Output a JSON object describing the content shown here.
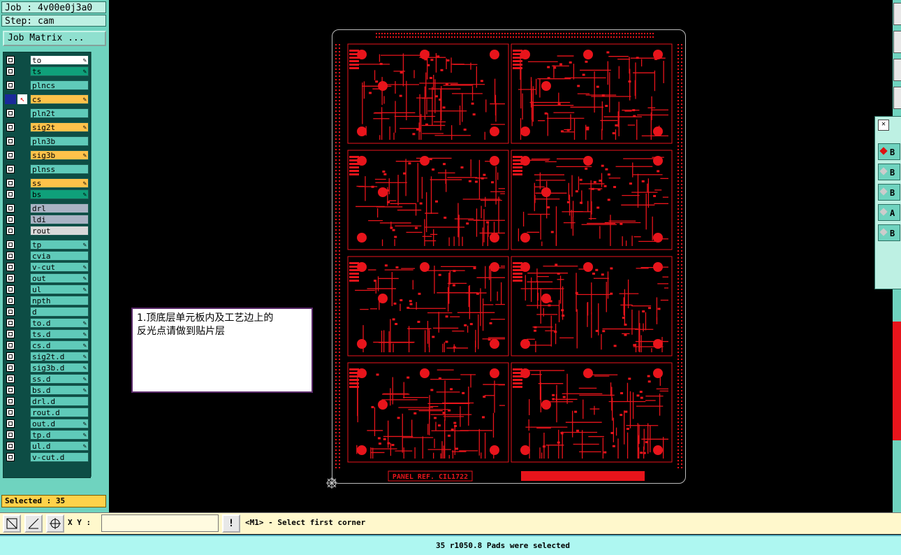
{
  "header": {
    "job": "Job : 4v00e0j3a0",
    "step": "Step: cam"
  },
  "job_matrix_label": "Job Matrix ...",
  "layers": [
    {
      "name": "to",
      "color": "#ffffff",
      "edit": true
    },
    {
      "name": "ts",
      "color": "#0fa07a",
      "edit": true
    },
    {
      "name": "plncs",
      "color": "#5fcab9",
      "edit": false
    },
    {
      "name": "cs",
      "color": "#ffc24a",
      "edit": true,
      "active": true
    },
    {
      "name": "pln2t",
      "color": "#5fcab9",
      "edit": false
    },
    {
      "name": "sig2t",
      "color": "#ffc24a",
      "edit": true
    },
    {
      "name": "pln3b",
      "color": "#5fcab9",
      "edit": false
    },
    {
      "name": "sig3b",
      "color": "#ffc24a",
      "edit": true
    },
    {
      "name": "plnss",
      "color": "#5fcab9",
      "edit": false
    },
    {
      "name": "ss",
      "color": "#ffc24a",
      "edit": true
    },
    {
      "name": "bs",
      "color": "#0fa07a",
      "edit": true
    },
    {
      "name": "drl",
      "color": "#a9b3c4",
      "edit": false
    },
    {
      "name": "ldi",
      "color": "#a9b3c4",
      "edit": false
    },
    {
      "name": "rout",
      "color": "#d9d9d9",
      "edit": false
    },
    {
      "name": "tp",
      "color": "#5fcab9",
      "edit": true
    },
    {
      "name": "cvia",
      "color": "#5fcab9",
      "edit": false
    },
    {
      "name": "v-cut",
      "color": "#5fcab9",
      "edit": true
    },
    {
      "name": "out",
      "color": "#5fcab9",
      "edit": true
    },
    {
      "name": "ul",
      "color": "#5fcab9",
      "edit": true
    },
    {
      "name": "npth",
      "color": "#5fcab9",
      "edit": false
    },
    {
      "name": "d",
      "color": "#5fcab9",
      "edit": false
    },
    {
      "name": "to.d",
      "color": "#5fcab9",
      "edit": true
    },
    {
      "name": "ts.d",
      "color": "#5fcab9",
      "edit": true
    },
    {
      "name": "cs.d",
      "color": "#5fcab9",
      "edit": true
    },
    {
      "name": "sig2t.d",
      "color": "#5fcab9",
      "edit": true
    },
    {
      "name": "sig3b.d",
      "color": "#5fcab9",
      "edit": true
    },
    {
      "name": "ss.d",
      "color": "#5fcab9",
      "edit": true
    },
    {
      "name": "bs.d",
      "color": "#5fcab9",
      "edit": true
    },
    {
      "name": "drl.d",
      "color": "#5fcab9",
      "edit": false
    },
    {
      "name": "rout.d",
      "color": "#5fcab9",
      "edit": false
    },
    {
      "name": "out.d",
      "color": "#5fcab9",
      "edit": true
    },
    {
      "name": "tp.d",
      "color": "#5fcab9",
      "edit": true
    },
    {
      "name": "ul.d",
      "color": "#5fcab9",
      "edit": true
    },
    {
      "name": "v-cut.d",
      "color": "#5fcab9",
      "edit": false
    }
  ],
  "selected_label": "Selected : 35",
  "panel_ref_text": "PANEL REF. CIL1722",
  "trace_color": "#e8141b",
  "note": {
    "line1": "1.顶底层单元板内及工艺边上的",
    "line2": "反光点请做到贴片层"
  },
  "cmd": {
    "xy_label": "X Y :",
    "xy_value": "",
    "warn": "!",
    "prompt": "<M1> - Select first corner"
  },
  "status": "35 r1050.8 Pads were selected",
  "float_panel_items": [
    "B",
    "B",
    "B",
    "A",
    "B"
  ]
}
